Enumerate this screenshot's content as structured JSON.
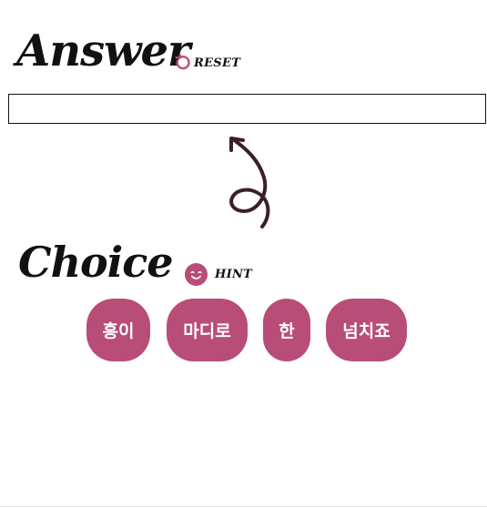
{
  "answer": {
    "title": "Answer",
    "reset_label": "RESET",
    "input_value": ""
  },
  "choice": {
    "title": "Choice",
    "hint_label": "HINT",
    "chips": [
      "흥이",
      "마디로",
      "한",
      "넘치죠"
    ]
  },
  "colors": {
    "accent": "#b84d77",
    "arrow": "#3a1f2b",
    "text": "#111111"
  },
  "icons": {
    "reset": "reset-icon",
    "hint": "smile-icon",
    "arrow": "curly-arrow-icon"
  }
}
